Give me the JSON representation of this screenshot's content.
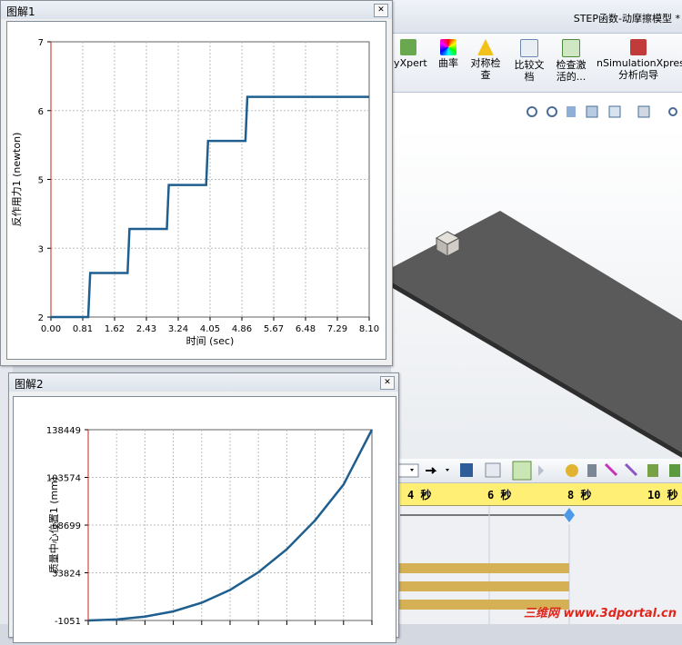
{
  "app": {
    "title": "STEP函数-动摩擦模型 *",
    "ribbon": [
      {
        "label": "lyXpert",
        "icon": "flyxpert-icon"
      },
      {
        "label": "曲率",
        "icon": "curvature-icon"
      },
      {
        "label": "对称检查",
        "icon": "symmetry-check-icon"
      },
      {
        "label": "比较文档",
        "icon": "compare-documents-icon"
      },
      {
        "label": "检查激活的...",
        "icon": "check-active-icon"
      },
      {
        "label": "nSimulationXpress 分析向导",
        "icon": "simulationxpress-icon"
      }
    ],
    "timeline": {
      "marks": [
        "4 秒",
        "6 秒",
        "8 秒",
        "10 秒"
      ]
    },
    "watermark": "三维网 www.3dportal.cn"
  },
  "plot1": {
    "title": "图解1",
    "close": "✕",
    "chart_data": {
      "type": "line",
      "xlabel": "时间 (sec)",
      "ylabel": "反作用力1 (newton)",
      "x_ticks": [
        "0.00",
        "0.81",
        "1.62",
        "2.43",
        "3.24",
        "4.05",
        "4.86",
        "5.67",
        "6.48",
        "7.29",
        "8.10"
      ],
      "y_ticks": [
        "2",
        "3",
        "5",
        "6",
        "7"
      ],
      "xlim": [
        0,
        8.1
      ],
      "ylim": [
        2,
        7
      ],
      "grid": true,
      "series": [
        {
          "color": "#1f5f8f",
          "x": [
            0,
            0.95,
            1.0,
            1.95,
            2.0,
            2.95,
            3.0,
            3.95,
            4.0,
            4.95,
            5.0,
            8.1
          ],
          "y": [
            2,
            2,
            2.8,
            2.8,
            3.6,
            3.6,
            4.4,
            4.4,
            5.2,
            5.2,
            6.0,
            6.0
          ]
        }
      ]
    }
  },
  "plot2": {
    "title": "图解2",
    "close": "✕",
    "chart_data": {
      "type": "line",
      "xlabel": "",
      "ylabel": "质量中心位置1 (mm)",
      "y_ticks": [
        "-1051",
        "33824",
        "68699",
        "103574",
        "138449"
      ],
      "ylim": [
        -1051,
        138449
      ],
      "xlim": [
        0,
        8.1
      ],
      "grid": true,
      "series": [
        {
          "color": "#1f5f8f",
          "x": [
            0,
            0.81,
            1.62,
            2.43,
            3.24,
            4.05,
            4.86,
            5.67,
            6.48,
            7.29,
            8.1
          ],
          "y": [
            -1051,
            -300,
            1800,
            5600,
            11900,
            21300,
            34200,
            51000,
            72200,
            98300,
            138449
          ]
        }
      ]
    }
  }
}
